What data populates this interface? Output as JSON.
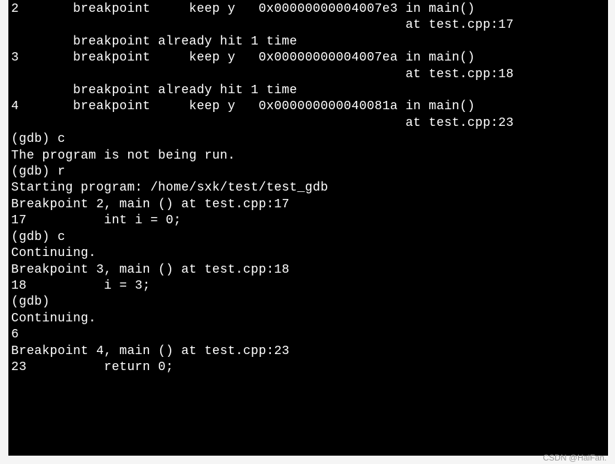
{
  "terminal": {
    "lines": [
      "2       breakpoint     keep y   0x00000000004007e3 in main()",
      "                                                   at test.cpp:17",
      "        breakpoint already hit 1 time",
      "3       breakpoint     keep y   0x00000000004007ea in main()",
      "                                                   at test.cpp:18",
      "        breakpoint already hit 1 time",
      "4       breakpoint     keep y   0x000000000040081a in main()",
      "                                                   at test.cpp:23",
      "(gdb) c",
      "The program is not being run.",
      "(gdb) r",
      "Starting program: /home/sxk/test/test_gdb",
      "",
      "Breakpoint 2, main () at test.cpp:17",
      "17          int i = 0;",
      "(gdb) c",
      "Continuing.",
      "",
      "Breakpoint 3, main () at test.cpp:18",
      "18          i = 3;",
      "(gdb)",
      "Continuing.",
      "6",
      "",
      "Breakpoint 4, main () at test.cpp:23",
      "23          return 0;"
    ]
  },
  "watermark": "CSDN @HaiFan."
}
